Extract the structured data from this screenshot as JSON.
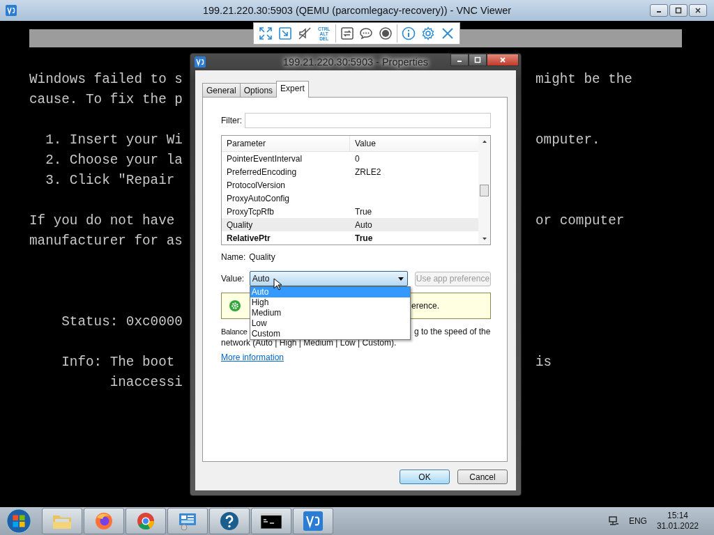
{
  "vnc_window": {
    "title": "199.21.220.30:5903 (QEMU (parcomlegacy-recovery)) - VNC Viewer"
  },
  "toolbar": [
    {
      "kind": "fullscreen"
    },
    {
      "kind": "scale"
    },
    {
      "kind": "mute"
    },
    {
      "kind": "keys",
      "label": [
        "CTRL",
        "ALT",
        "DEL"
      ]
    },
    {
      "kind": "transfer"
    },
    {
      "kind": "chat"
    },
    {
      "kind": "record"
    },
    {
      "kind": "info"
    },
    {
      "kind": "settings"
    },
    {
      "kind": "close"
    }
  ],
  "console": [
    {
      "kind": "body",
      "lines": [
        {
          "left": "Windows failed to s",
          "right": "might be the"
        },
        {
          "left": "cause. To fix the p"
        }
      ]
    },
    {
      "kind": "list",
      "lines": [
        {
          "left": "1. Insert your Wi",
          "right": "omputer."
        },
        {
          "left": "2. Choose your la"
        },
        {
          "left": "3. Click \"Repair"
        }
      ]
    },
    {
      "kind": "body",
      "lines": [
        {
          "left": "If you do not have",
          "right": "or computer"
        },
        {
          "left": "manufacturer for as"
        }
      ]
    },
    {
      "kind": "detail",
      "lines": [
        {
          "left": "Status: 0xc0000"
        }
      ]
    },
    {
      "kind": "detail",
      "lines": [
        {
          "left": "Info: The boot",
          "right": "is"
        },
        {
          "left": "inaccessi"
        }
      ]
    }
  ],
  "dialog": {
    "title": "199.21.220.30:5903 - Properties",
    "tabs": [
      {
        "label": "General",
        "selected": false
      },
      {
        "label": "Options",
        "selected": false
      },
      {
        "label": "Expert",
        "selected": true
      }
    ],
    "filter": {
      "label": "Filter:"
    },
    "table": {
      "columns": [
        "Parameter",
        "Value"
      ],
      "rows": [
        {
          "parameter": "PointerEventInterval",
          "value": "0",
          "selected": false,
          "modified": false
        },
        {
          "parameter": "PreferredEncoding",
          "value": "ZRLE2",
          "selected": false,
          "modified": false
        },
        {
          "parameter": "ProtocolVersion",
          "selected": false,
          "modified": false
        },
        {
          "parameter": "ProxyAutoConfig",
          "selected": false,
          "modified": false
        },
        {
          "parameter": "ProxyTcpRfb",
          "value": "True",
          "selected": false,
          "modified": false
        },
        {
          "parameter": "Quality",
          "value": "Auto",
          "selected": true,
          "modified": false
        },
        {
          "parameter": "RelativePtr",
          "value": "True",
          "selected": false,
          "modified": true
        }
      ]
    },
    "name": {
      "label": "Name:",
      "value": "Quality"
    },
    "value": {
      "label": "Value:",
      "selected_text": "Auto",
      "expanded": true,
      "options": [
        {
          "label": "Auto",
          "selected": true
        },
        {
          "label": "High",
          "selected": false
        },
        {
          "label": "Medium",
          "selected": false
        },
        {
          "label": "Low",
          "selected": false
        },
        {
          "label": "Custom",
          "selected": false
        }
      ]
    },
    "reset_button": {
      "label": "Use app preference",
      "disabled": true
    },
    "notice": "erence.",
    "description": {
      "line_1_left": "Balance",
      "line_1_right": "g to the speed of the",
      "line_2": "network (Auto | High | Medium | Low | Custom)."
    },
    "link": "More information",
    "buttons": [
      {
        "label": "OK",
        "default": true
      },
      {
        "label": "Cancel",
        "default": false
      }
    ]
  },
  "taskbar": {
    "apps": [
      {
        "kind": "explorer"
      },
      {
        "kind": "firefox"
      },
      {
        "kind": "chrome"
      },
      {
        "kind": "control_panel"
      },
      {
        "kind": "help"
      },
      {
        "kind": "terminal"
      },
      {
        "kind": "vnc"
      }
    ],
    "language": "ENG",
    "time": "15:14",
    "date": "31.01.2022"
  }
}
